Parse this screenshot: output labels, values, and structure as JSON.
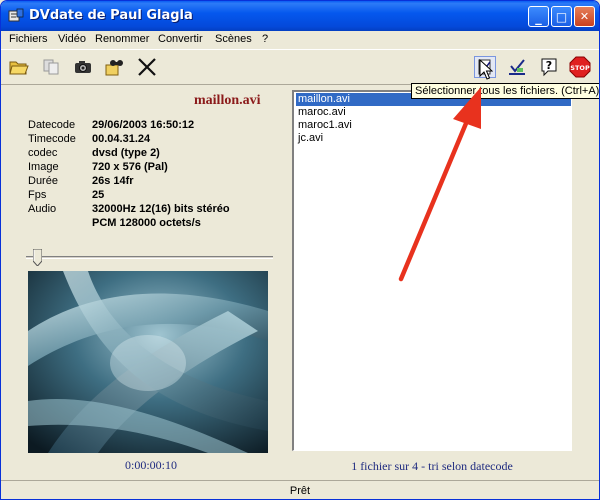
{
  "window": {
    "title": "DVdate de Paul Glagla"
  },
  "title_buttons": {
    "minimize": "_",
    "maximize": "□",
    "close": "✕"
  },
  "menu": [
    "Fichiers",
    "Vidéo",
    "Renommer",
    "Convertir",
    "Scènes",
    "?"
  ],
  "toolbar": {
    "left": [
      {
        "icon": "open-folder-icon"
      },
      {
        "icon": "copy-icon"
      },
      {
        "icon": "camera-icon"
      },
      {
        "icon": "find-icon"
      },
      {
        "icon": "delete-x-icon"
      }
    ],
    "right": [
      {
        "icon": "select-all-icon"
      },
      {
        "icon": "check-chart-icon"
      },
      {
        "icon": "help-icon"
      },
      {
        "icon": "stop-icon",
        "label": "STOP"
      }
    ]
  },
  "file_info": {
    "title": "maillon.avi",
    "rows": [
      {
        "label": "Datecode",
        "value": "29/06/2003 16:50:12"
      },
      {
        "label": "Timecode",
        "value": "00.04.31.24"
      },
      {
        "label": "codec",
        "value": "dvsd (type 2)"
      },
      {
        "label": "Image",
        "value": "720 x 576 (Pal)"
      },
      {
        "label": "Durée",
        "value": "26s 14fr"
      },
      {
        "label": "Fps",
        "value": "25"
      },
      {
        "label": "Audio",
        "value": "32000Hz 12(16) bits  stéréo"
      },
      {
        "label": "",
        "value": "PCM 128000 octets/s"
      }
    ]
  },
  "player": {
    "position": 0.03,
    "timecode": "0:00:00:10"
  },
  "file_list": {
    "items": [
      "maillon.avi",
      "maroc.avi",
      "maroc1.avi",
      "jc.avi"
    ],
    "selected_index": 0,
    "summary": "1 fichier sur 4 - tri selon datecode"
  },
  "tooltip": "Sélectionner tous les fichiers. (Ctrl+A)",
  "status": "Prêt",
  "colors": {
    "title_bar": "#0558EE",
    "selection": "#316AC5",
    "filename": "#8B1A1A",
    "info_text": "#1F2B80",
    "arrow": "#E8321E"
  }
}
